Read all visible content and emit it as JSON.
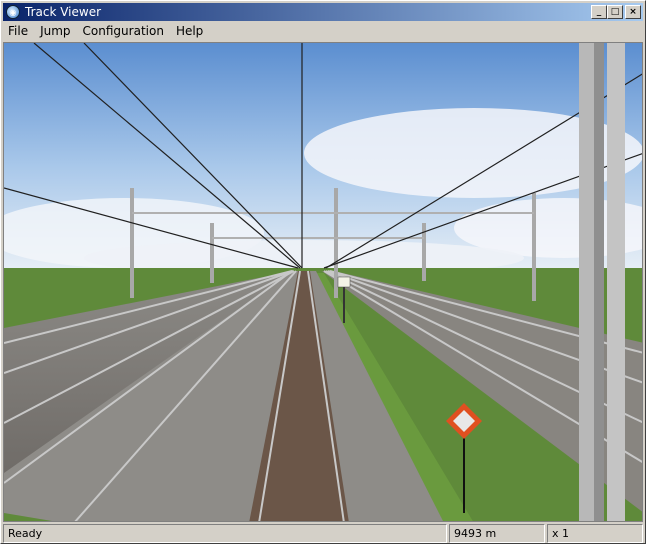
{
  "window": {
    "title": "Track Viewer",
    "icon": "app-globe-icon",
    "controls": {
      "minimize": "_",
      "maximize": "□",
      "close": "×"
    }
  },
  "menu": {
    "items": [
      {
        "label": "File"
      },
      {
        "label": "Jump"
      },
      {
        "label": "Configuration"
      },
      {
        "label": "Help"
      }
    ]
  },
  "scene": {
    "sky_color": "#6f9ed6",
    "ground_color": "#5f8a3a",
    "signal_color": "#e05020"
  },
  "status": {
    "message": "Ready",
    "distance": "9493 m",
    "speed_factor": "x 1"
  }
}
